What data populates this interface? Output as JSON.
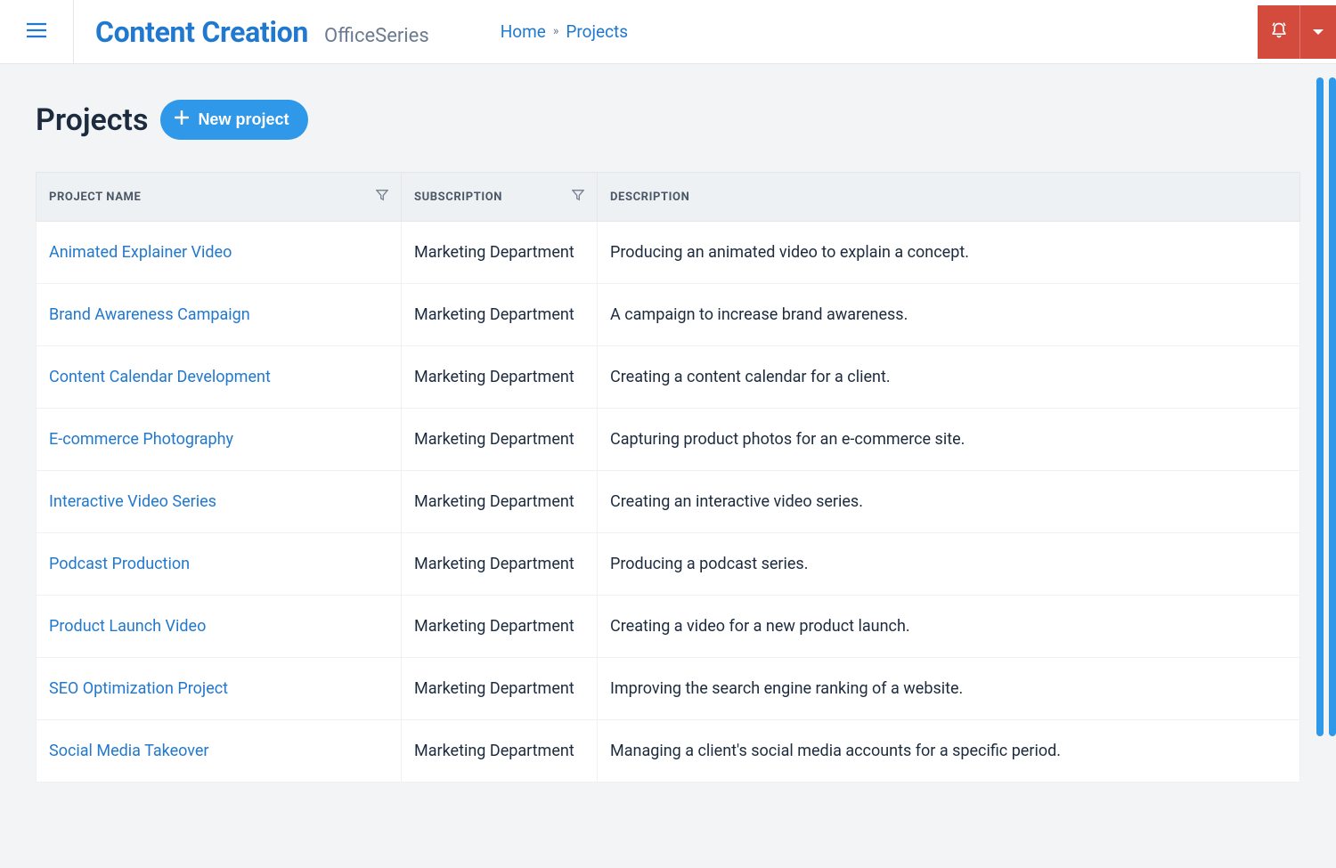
{
  "header": {
    "brand_title": "Content Creation",
    "brand_sub": "OfficeSeries",
    "breadcrumb_home": "Home",
    "breadcrumb_current": "Projects"
  },
  "page": {
    "title": "Projects",
    "new_button": "New project"
  },
  "table": {
    "headers": {
      "name": "Project Name",
      "subscription": "Subscription",
      "description": "Description"
    },
    "rows": [
      {
        "name": "Animated Explainer Video",
        "subscription": "Marketing Department",
        "description": "Producing an animated video to explain a concept."
      },
      {
        "name": "Brand Awareness Campaign",
        "subscription": "Marketing Department",
        "description": "A campaign to increase brand awareness."
      },
      {
        "name": "Content Calendar Development",
        "subscription": "Marketing Department",
        "description": "Creating a content calendar for a client."
      },
      {
        "name": "E-commerce Photography",
        "subscription": "Marketing Department",
        "description": "Capturing product photos for an e-commerce site."
      },
      {
        "name": "Interactive Video Series",
        "subscription": "Marketing Department",
        "description": "Creating an interactive video series."
      },
      {
        "name": "Podcast Production",
        "subscription": "Marketing Department",
        "description": "Producing a podcast series."
      },
      {
        "name": "Product Launch Video",
        "subscription": "Marketing Department",
        "description": "Creating a video for a new product launch."
      },
      {
        "name": "SEO Optimization Project",
        "subscription": "Marketing Department",
        "description": "Improving the search engine ranking of a website."
      },
      {
        "name": "Social Media Takeover",
        "subscription": "Marketing Department",
        "description": "Managing a client's social media accounts for a specific period."
      }
    ]
  }
}
